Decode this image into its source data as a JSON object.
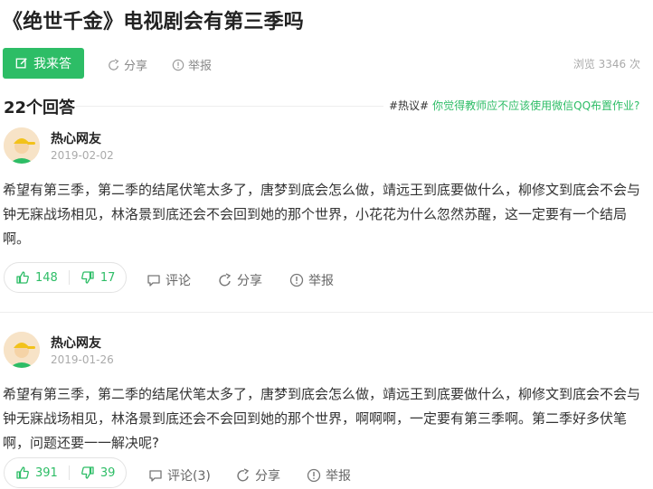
{
  "page": {
    "title": "《绝世千金》电视剧会有第三季吗",
    "answer_button": "我来答",
    "share": "分享",
    "report": "举报",
    "views": "浏览 3346 次"
  },
  "answers_header": {
    "count": "22个回答",
    "hot_tag": "#热议#",
    "hot_question": "你觉得教师应不应该使用微信QQ布置作业?"
  },
  "answers": [
    {
      "author": "热心网友",
      "date": "2019-02-02",
      "content": "希望有第三季，第二季的结尾伏笔太多了，唐梦到底会怎么做，靖远王到底要做什么，柳修文到底会不会与钟无寐战场相见，林洛景到底还会不会回到她的那个世界，小花花为什么忽然苏醒，这一定要有一个结局啊。",
      "likes": "148",
      "dislikes": "17",
      "comment": "评论",
      "share": "分享",
      "report": "举报"
    },
    {
      "author": "热心网友",
      "date": "2019-01-26",
      "content": "希望有第三季，第二季的结尾伏笔太多了，唐梦到底会怎么做，靖远王到底要做什么，柳修文到底会不会与钟无寐战场相见，林洛景到底还会不会回到她的那个世界，啊啊啊，一定要有第三季啊。第二季好多伏笔啊，问题还要一一解决呢?",
      "likes": "391",
      "dislikes": "39",
      "comment": "评论(3)",
      "share": "分享",
      "report": "举报"
    }
  ],
  "colors": {
    "accent": "#2dbd66",
    "muted": "#888888"
  },
  "icons": [
    "edit-icon",
    "share-icon",
    "report-icon",
    "thumbs-up-icon",
    "thumbs-down-icon",
    "comment-icon",
    "avatar-icon"
  ]
}
